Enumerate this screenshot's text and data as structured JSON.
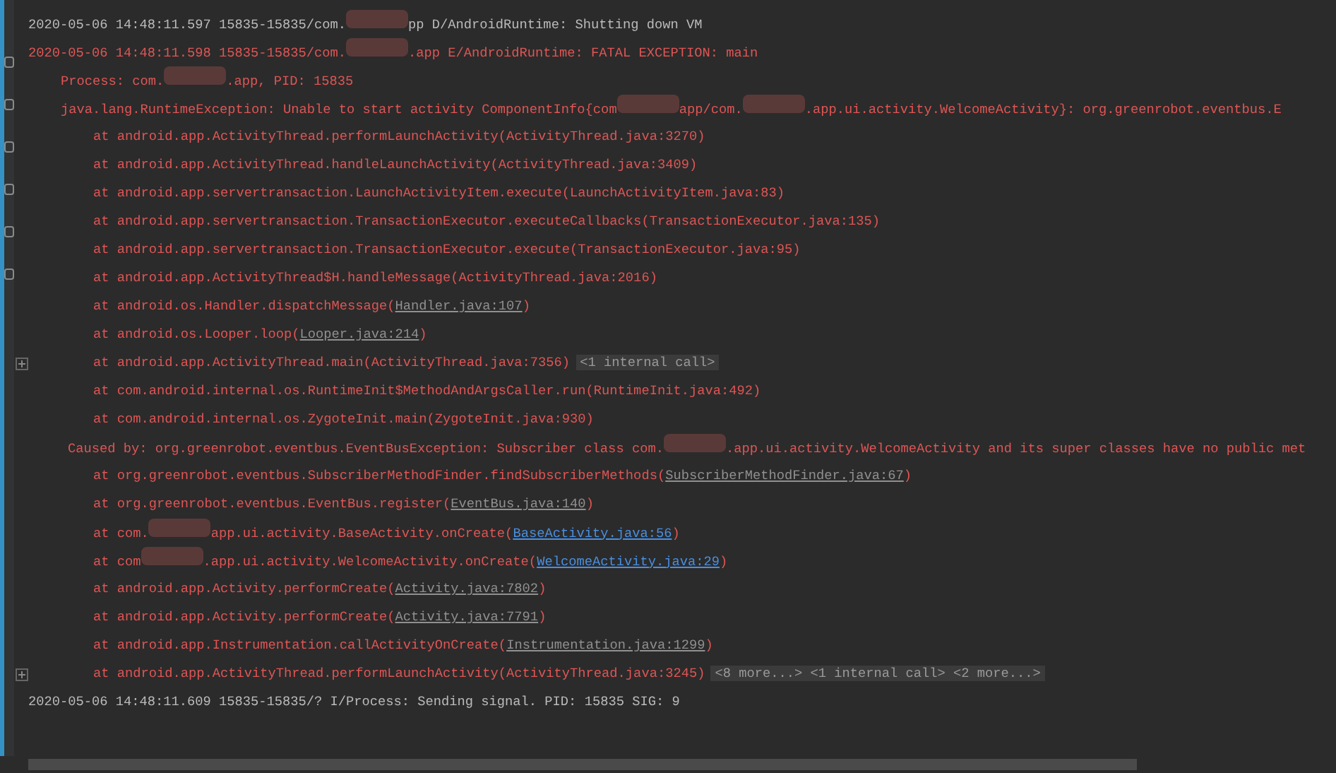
{
  "log_lines": [
    {
      "kind": "header",
      "error": false,
      "parts": [
        {
          "kind": "text",
          "text": "2020-05-06 14:48:11.597 15835-15835/com."
        },
        {
          "kind": "redacted"
        },
        {
          "kind": "text",
          "text": "pp D/AndroidRuntime: Shutting down VM"
        }
      ]
    },
    {
      "kind": "header",
      "error": true,
      "parts": [
        {
          "kind": "text",
          "text": "2020-05-06 14:48:11.598 15835-15835/com."
        },
        {
          "kind": "redacted"
        },
        {
          "kind": "text",
          "text": ".app E/AndroidRuntime: FATAL EXCEPTION: main"
        }
      ]
    },
    {
      "kind": "detail",
      "error": true,
      "parts": [
        {
          "kind": "text",
          "text": "Process: com."
        },
        {
          "kind": "redacted"
        },
        {
          "kind": "text",
          "text": ".app, PID: 15835"
        }
      ]
    },
    {
      "kind": "detail",
      "error": true,
      "parts": [
        {
          "kind": "text",
          "text": "java.lang.RuntimeException: Unable to start activity ComponentInfo{com"
        },
        {
          "kind": "redacted"
        },
        {
          "kind": "text",
          "text": "app/com."
        },
        {
          "kind": "redacted"
        },
        {
          "kind": "text",
          "text": ".app.ui.activity.WelcomeActivity}: org.greenrobot.eventbus.E"
        }
      ]
    },
    {
      "kind": "frame",
      "error": true,
      "parts": [
        {
          "kind": "text",
          "text": "at android.app.ActivityThread.performLaunchActivity(ActivityThread.java:3270)"
        }
      ]
    },
    {
      "kind": "frame",
      "error": true,
      "parts": [
        {
          "kind": "text",
          "text": "at android.app.ActivityThread.handleLaunchActivity(ActivityThread.java:3409)"
        }
      ]
    },
    {
      "kind": "frame",
      "error": true,
      "parts": [
        {
          "kind": "text",
          "text": "at android.app.servertransaction.LaunchActivityItem.execute(LaunchActivityItem.java:83)"
        }
      ]
    },
    {
      "kind": "frame",
      "error": true,
      "parts": [
        {
          "kind": "text",
          "text": "at android.app.servertransaction.TransactionExecutor.executeCallbacks(TransactionExecutor.java:135)"
        }
      ]
    },
    {
      "kind": "frame",
      "error": true,
      "parts": [
        {
          "kind": "text",
          "text": "at android.app.servertransaction.TransactionExecutor.execute(TransactionExecutor.java:95)"
        }
      ]
    },
    {
      "kind": "frame",
      "error": true,
      "parts": [
        {
          "kind": "text",
          "text": "at android.app.ActivityThread$H.handleMessage(ActivityThread.java:2016)"
        }
      ]
    },
    {
      "kind": "frame",
      "error": true,
      "parts": [
        {
          "kind": "text",
          "text": "at android.os.Handler.dispatchMessage("
        },
        {
          "kind": "file-link",
          "text": "Handler.java:107"
        },
        {
          "kind": "text",
          "text": ")"
        }
      ]
    },
    {
      "kind": "frame",
      "error": true,
      "parts": [
        {
          "kind": "text",
          "text": "at android.os.Looper.loop("
        },
        {
          "kind": "file-link",
          "text": "Looper.java:214"
        },
        {
          "kind": "text",
          "text": ")"
        }
      ]
    },
    {
      "kind": "frame",
      "error": true,
      "foldable": true,
      "parts": [
        {
          "kind": "text",
          "text": "at android.app.ActivityThread.main(ActivityThread.java:7356)"
        },
        {
          "kind": "fold",
          "text": "<1 internal call>"
        }
      ]
    },
    {
      "kind": "frame",
      "error": true,
      "parts": [
        {
          "kind": "text",
          "text": "at com.android.internal.os.RuntimeInit$MethodAndArgsCaller.run(RuntimeInit.java:492)"
        }
      ]
    },
    {
      "kind": "frame",
      "error": true,
      "parts": [
        {
          "kind": "text",
          "text": "at com.android.internal.os.ZygoteInit.main(ZygoteInit.java:930)"
        }
      ]
    },
    {
      "kind": "cause",
      "error": true,
      "parts": [
        {
          "kind": "text",
          "text": "Caused by: org.greenrobot.eventbus.EventBusException: Subscriber class com."
        },
        {
          "kind": "redacted"
        },
        {
          "kind": "text",
          "text": ".app.ui.activity.WelcomeActivity and its super classes have no public met"
        }
      ]
    },
    {
      "kind": "frame",
      "error": true,
      "parts": [
        {
          "kind": "text",
          "text": "at org.greenrobot.eventbus.SubscriberMethodFinder.findSubscriberMethods("
        },
        {
          "kind": "file-link",
          "text": "SubscriberMethodFinder.java:67"
        },
        {
          "kind": "text",
          "text": ")"
        }
      ]
    },
    {
      "kind": "frame",
      "error": true,
      "parts": [
        {
          "kind": "text",
          "text": "at org.greenrobot.eventbus.EventBus.register("
        },
        {
          "kind": "file-link",
          "text": "EventBus.java:140"
        },
        {
          "kind": "text",
          "text": ")"
        }
      ]
    },
    {
      "kind": "frame",
      "error": true,
      "parts": [
        {
          "kind": "text",
          "text": "at com."
        },
        {
          "kind": "redacted"
        },
        {
          "kind": "text",
          "text": "app.ui.activity.BaseActivity.onCreate("
        },
        {
          "kind": "project-link",
          "text": "BaseActivity.java:56"
        },
        {
          "kind": "text",
          "text": ")"
        }
      ]
    },
    {
      "kind": "frame",
      "error": true,
      "parts": [
        {
          "kind": "text",
          "text": "at com"
        },
        {
          "kind": "redacted"
        },
        {
          "kind": "text",
          "text": ".app.ui.activity.WelcomeActivity.onCreate("
        },
        {
          "kind": "project-link",
          "text": "WelcomeActivity.java:29"
        },
        {
          "kind": "text",
          "text": ")"
        }
      ]
    },
    {
      "kind": "frame",
      "error": true,
      "parts": [
        {
          "kind": "text",
          "text": "at android.app.Activity.performCreate("
        },
        {
          "kind": "file-link",
          "text": "Activity.java:7802"
        },
        {
          "kind": "text",
          "text": ")"
        }
      ]
    },
    {
      "kind": "frame",
      "error": true,
      "parts": [
        {
          "kind": "text",
          "text": "at android.app.Activity.performCreate("
        },
        {
          "kind": "file-link",
          "text": "Activity.java:7791"
        },
        {
          "kind": "text",
          "text": ")"
        }
      ]
    },
    {
      "kind": "frame",
      "error": true,
      "parts": [
        {
          "kind": "text",
          "text": "at android.app.Instrumentation.callActivityOnCreate("
        },
        {
          "kind": "file-link",
          "text": "Instrumentation.java:1299"
        },
        {
          "kind": "text",
          "text": ")"
        }
      ]
    },
    {
      "kind": "frame",
      "error": true,
      "foldable": true,
      "parts": [
        {
          "kind": "text",
          "text": "at android.app.ActivityThread.performLaunchActivity(ActivityThread.java:3245)"
        },
        {
          "kind": "fold",
          "text": "<8 more...> <1 internal call> <2 more...>"
        }
      ]
    },
    {
      "kind": "header",
      "error": false,
      "parts": [
        {
          "kind": "text",
          "text": "2020-05-06 14:48:11.609 15835-15835/? I/Process: Sending signal. PID: 15835 SIG: 9"
        }
      ]
    }
  ]
}
